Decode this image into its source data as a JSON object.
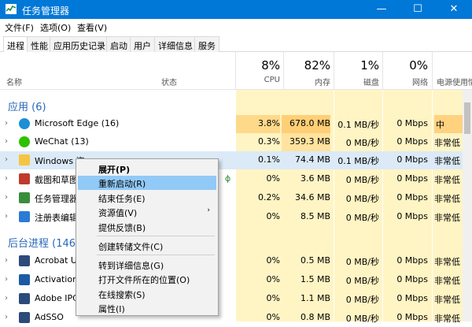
{
  "window": {
    "title": "任务管理器",
    "minimize": "—",
    "maximize": "☐",
    "close": "✕"
  },
  "menu": [
    "文件(F)",
    "选项(O)",
    "查看(V)"
  ],
  "tabs": [
    "进程",
    "性能",
    "应用历史记录",
    "启动",
    "用户",
    "详细信息",
    "服务"
  ],
  "columns": {
    "name": "名称",
    "status": "状态",
    "cpu": {
      "pct": "8%",
      "label": "CPU"
    },
    "mem": {
      "pct": "82%",
      "label": "内存"
    },
    "disk": {
      "pct": "1%",
      "label": "磁盘"
    },
    "net": {
      "pct": "0%",
      "label": "网络"
    },
    "power": "电源使用情"
  },
  "groups": {
    "apps": "应用 (6)",
    "background": "后台进程 (146"
  },
  "rows": [
    {
      "name": "Microsoft Edge (16)",
      "cpu": "3.8%",
      "mem": "678.0 MB",
      "disk": "0.1 MB/秒",
      "net": "0 Mbps",
      "power": "中",
      "icon": "edge-icon",
      "color": "#1a8fd8"
    },
    {
      "name": "WeChat (13)",
      "cpu": "0.3%",
      "mem": "359.3 MB",
      "disk": "0 MB/秒",
      "net": "0 Mbps",
      "power": "非常低",
      "icon": "wechat-icon",
      "color": "#2dc100"
    },
    {
      "name": "Windows 资",
      "cpu": "0.1%",
      "mem": "74.4 MB",
      "disk": "0.1 MB/秒",
      "net": "0 Mbps",
      "power": "非常低",
      "icon": "folder-icon",
      "color": "#f5c542"
    },
    {
      "name": "截图和草图",
      "cpu": "0%",
      "mem": "3.6 MB",
      "disk": "0 MB/秒",
      "net": "0 Mbps",
      "power": "非常低",
      "icon": "snip-icon",
      "color": "#c0392b"
    },
    {
      "name": "任务管理器",
      "cpu": "0.2%",
      "mem": "34.6 MB",
      "disk": "0 MB/秒",
      "net": "0 Mbps",
      "power": "非常低",
      "icon": "taskmgr-icon",
      "color": "#3a8d3a"
    },
    {
      "name": "注册表编辑",
      "cpu": "0%",
      "mem": "8.5 MB",
      "disk": "0 MB/秒",
      "net": "0 Mbps",
      "power": "非常低",
      "icon": "regedit-icon",
      "color": "#2b7bd6"
    },
    {
      "name": "Acrobat U",
      "cpu": "0%",
      "mem": "0.5 MB",
      "disk": "0 MB/秒",
      "net": "0 Mbps",
      "power": "非常低",
      "icon": "acrobat-icon",
      "color": "#2c4a7a"
    },
    {
      "name": "Activation",
      "cpu": "0%",
      "mem": "1.5 MB",
      "disk": "0 MB/秒",
      "net": "0 Mbps",
      "power": "非常低",
      "icon": "app-icon",
      "color": "#1c5aa6"
    },
    {
      "name": "Adobe IPC",
      "cpu": "0%",
      "mem": "1.1 MB",
      "disk": "0 MB/秒",
      "net": "0 Mbps",
      "power": "非常低",
      "icon": "app-icon",
      "color": "#2c4a7a"
    },
    {
      "name": "AdSSO",
      "cpu": "0%",
      "mem": "0.8 MB",
      "disk": "0 MB/秒",
      "net": "0 Mbps",
      "power": "非常低",
      "icon": "app-icon",
      "color": "#2c4a7a"
    }
  ],
  "context_menu": [
    "展开(P)",
    "重新启动(R)",
    "结束任务(E)",
    "资源值(V)",
    "提供反馈(B)",
    "创建转储文件(C)",
    "转到详细信息(G)",
    "打开文件所在的位置(O)",
    "在线搜索(S)",
    "属性(I)"
  ],
  "colors": {
    "titlebar": "#0078d7",
    "heat_light": "#fff4c4",
    "heat_mid": "#ffe9a8",
    "heat_high": "#ffd27f",
    "selected": "#dbeaf6",
    "menu_highlight": "#91c9f7"
  }
}
